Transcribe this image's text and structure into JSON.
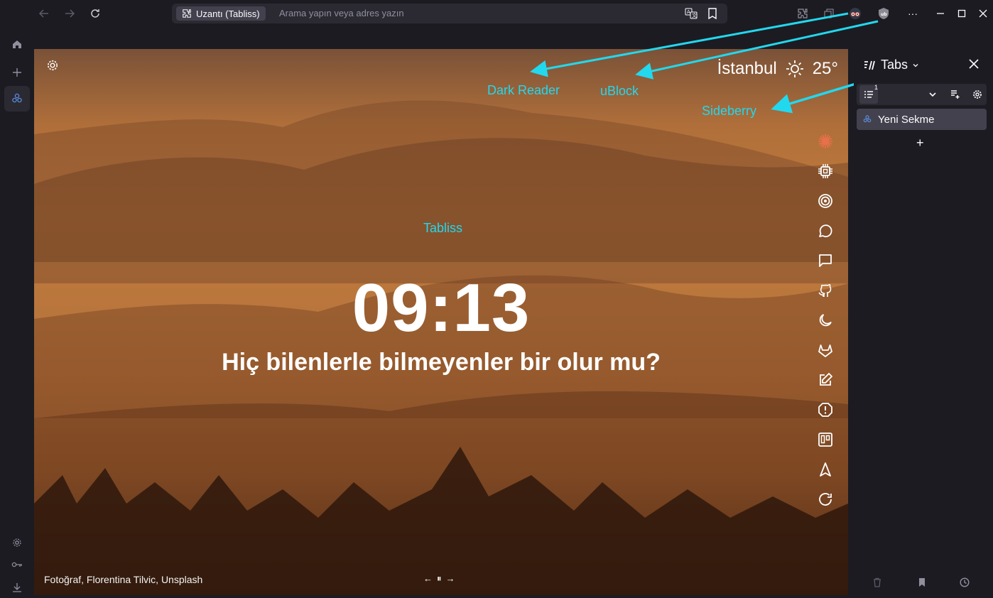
{
  "toolbar": {
    "back_icon": "arrow-left-icon",
    "forward_icon": "arrow-right-icon",
    "reload_icon": "reload-icon",
    "extension_chip_label": "Uzantı (Tabliss)",
    "url_placeholder": "Arama yapın veya adres yazın",
    "menu_dots": "···"
  },
  "content": {
    "city": "İstanbul",
    "temperature": "25°",
    "clock": "09:13",
    "quote": "Hiç bilenlerle bilmeyenler bir olur mu?",
    "photo_credit": "Fotoğraf, Florentina Tilvic, Unsplash",
    "bg_nav": {
      "prev": "←",
      "pause": "⏸",
      "next": "→"
    }
  },
  "annotations": {
    "dark_reader": "Dark Reader",
    "ublock": "uBlock",
    "sideberry": "Sideberry",
    "tabliss": "Tabliss"
  },
  "sidebar": {
    "title": "Tabs",
    "panel_count": "1",
    "tab_title": "Yeni Sekme",
    "add_symbol": "+"
  },
  "colors": {
    "chrome_bg": "#1c1b22",
    "urlbar_bg": "#2b2a33",
    "annotation": "#22d8ee",
    "active_tab": "#42414d"
  }
}
